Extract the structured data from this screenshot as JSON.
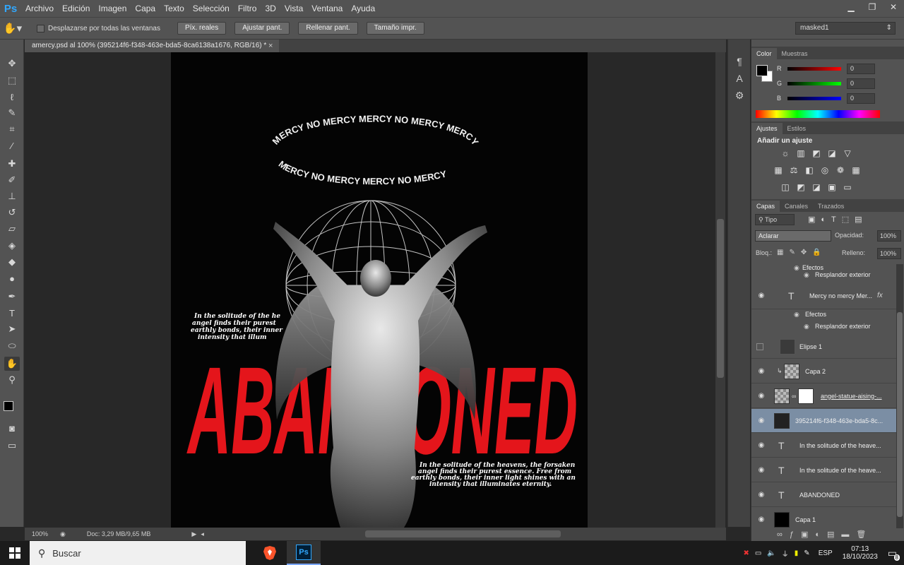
{
  "app": {
    "logo": "Ps"
  },
  "menu": [
    "Archivo",
    "Edición",
    "Imagen",
    "Capa",
    "Texto",
    "Selección",
    "Filtro",
    "3D",
    "Vista",
    "Ventana",
    "Ayuda"
  ],
  "options": {
    "scroll_all_label": "Desplazarse por todas las ventanas",
    "buttons": [
      "Píx. reales",
      "Ajustar pant.",
      "Rellenar pant.",
      "Tamaño impr."
    ],
    "workspace": "masked1"
  },
  "document": {
    "tab_title": "amercy.psd al 100% (395214f6-f348-463e-bda5-8ca6138a1676, RGB/16) *",
    "zoom": "100%",
    "doc_info": "Doc: 3,29 MB/9,65 MB"
  },
  "artwork": {
    "halo_top": "MERCY NO MERCY MERCY NO MERCY MERCY",
    "halo_bottom": "MERCY NO MERCY MERCY NO MERCY",
    "headline": "ABANDONED",
    "body_text_upper": [
      "In the solitude of the he",
      "angel finds their purest",
      "earthly bonds, their inner",
      "intensity that illum"
    ],
    "body_text_lower": [
      "In the solitude of the heavens, the forsaken",
      "angel finds their purest essence. Free from",
      "earthly bonds, their inner light shines with an",
      "intensity that illuminates eternity."
    ],
    "headline_color": "#e4151b"
  },
  "color_panel": {
    "tabs": [
      "Color",
      "Muestras"
    ],
    "r_label": "R",
    "g_label": "G",
    "b_label": "B",
    "r": "0",
    "g": "0",
    "b": "0"
  },
  "adjust_panel": {
    "tabs": [
      "Ajustes",
      "Estilos"
    ],
    "title": "Añadir un ajuste"
  },
  "layers_panel": {
    "tabs": [
      "Capas",
      "Canales",
      "Trazados"
    ],
    "filter": "Tipo",
    "blend_mode": "Aclarar",
    "opacity_label": "Opacidad:",
    "opacity": "100%",
    "lock_label": "Bloq.:",
    "fill_label": "Relleno:",
    "fill": "100%",
    "effects_label": "Efectos",
    "outer_glow_label": "Resplandor exterior",
    "layers": [
      {
        "name": "Mercy  no mercy Mer...",
        "type": "text",
        "fx": "fx"
      },
      {
        "name": "Elipse 1",
        "type": "shape"
      },
      {
        "name": "Capa 2",
        "type": "pixel"
      },
      {
        "name": "angel-statue-aising-...",
        "type": "pixel-mask"
      },
      {
        "name": "395214f6-f348-463e-bda5-8c...",
        "type": "smart",
        "selected": true
      },
      {
        "name": "In the solitude of the heave...",
        "type": "text"
      },
      {
        "name": "In the solitude of the heave...",
        "type": "text"
      },
      {
        "name": "ABANDONED",
        "type": "text"
      },
      {
        "name": "Capa 1",
        "type": "fill"
      }
    ]
  },
  "taskbar": {
    "search_placeholder": "Buscar",
    "lang": "ESP",
    "time": "07:13",
    "date": "18/10/2023",
    "notifications": "8"
  }
}
